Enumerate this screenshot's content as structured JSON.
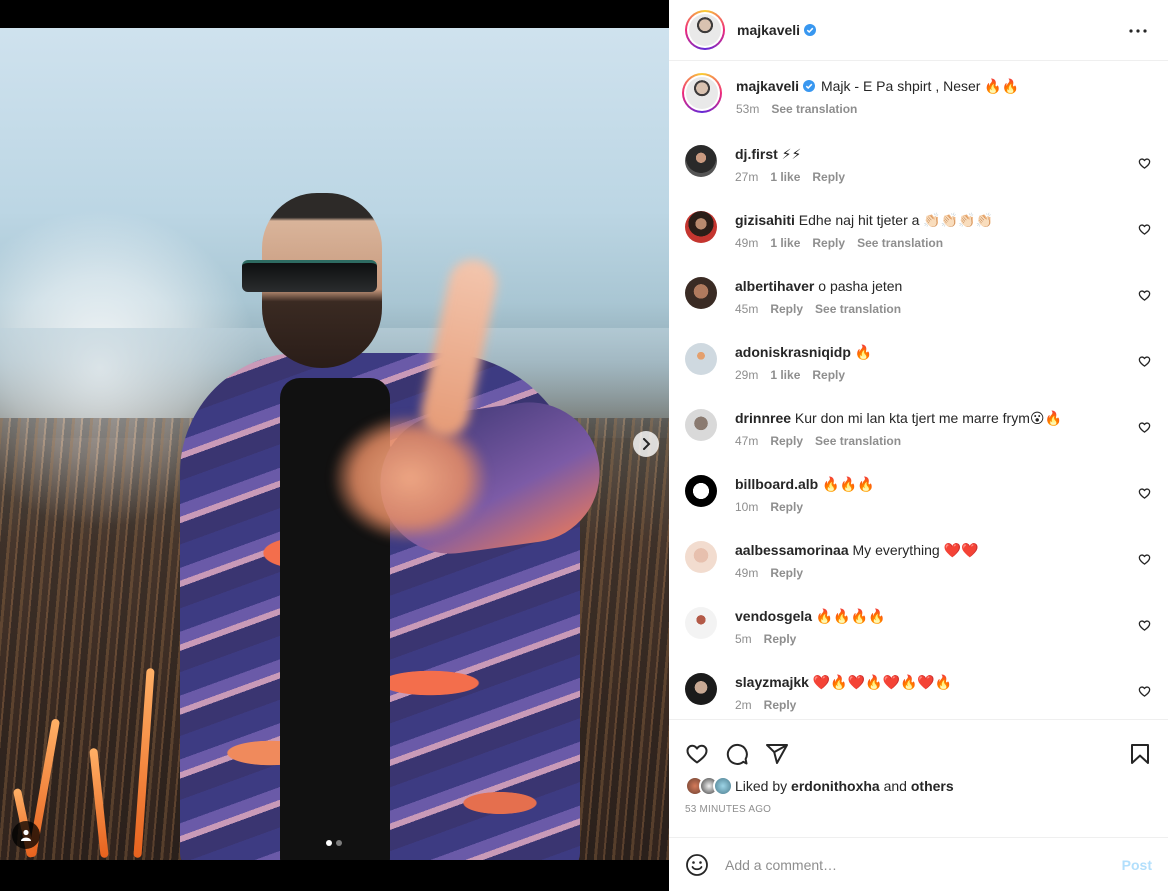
{
  "post": {
    "author": "majkaveli",
    "verified": true,
    "caption_text": "Majk - E Pa shpirt , Neser 🔥🔥",
    "caption_time": "53m",
    "see_translation": "See translation"
  },
  "carousel": {
    "total": 2,
    "active": 1
  },
  "comments": [
    {
      "user": "dj.first",
      "text": "⚡⚡",
      "time": "27m",
      "likes": "1 like",
      "reply": "Reply",
      "translation": ""
    },
    {
      "user": "gizisahiti",
      "text": "Edhe naj hit tjeter a 👏🏻👏🏻👏🏻👏🏻",
      "time": "49m",
      "likes": "1 like",
      "reply": "Reply",
      "translation": "See translation"
    },
    {
      "user": "albertihaver",
      "text": "o pasha jeten",
      "time": "45m",
      "likes": "",
      "reply": "Reply",
      "translation": "See translation"
    },
    {
      "user": "adoniskrasniqidp",
      "text": "🔥",
      "time": "29m",
      "likes": "1 like",
      "reply": "Reply",
      "translation": ""
    },
    {
      "user": "drinnree",
      "text": "Kur don mi lan kta tjert me marre frym😮🔥",
      "time": "47m",
      "likes": "",
      "reply": "Reply",
      "translation": "See translation"
    },
    {
      "user": "billboard.alb",
      "text": "🔥🔥🔥",
      "time": "10m",
      "likes": "",
      "reply": "Reply",
      "translation": ""
    },
    {
      "user": "aalbessamorinaa",
      "text": "My everything ❤️❤️",
      "time": "49m",
      "likes": "",
      "reply": "Reply",
      "translation": ""
    },
    {
      "user": "vendosgela",
      "text": "🔥🔥🔥🔥",
      "time": "5m",
      "likes": "",
      "reply": "Reply",
      "translation": ""
    },
    {
      "user": "slayzmajkk",
      "text": "❤️🔥❤️🔥❤️🔥❤️🔥",
      "time": "2m",
      "likes": "",
      "reply": "Reply",
      "translation": ""
    }
  ],
  "likes": {
    "prefix": "Liked by",
    "user": "erdonithoxha",
    "and": "and",
    "others": "others"
  },
  "timestamp": "53 MINUTES AGO",
  "add_comment": {
    "placeholder": "Add a comment…",
    "post_label": "Post"
  },
  "colors": {
    "link_blue": "#0095f6",
    "post_disabled": "#b2dffc",
    "verified_blue": "#3897f0",
    "meta_grey": "#8e8e8e"
  },
  "icons": [
    "more-icon",
    "heart-icon",
    "comment-icon",
    "share-icon",
    "bookmark-icon",
    "emoji-icon",
    "chevron-right-icon",
    "user-tag-icon",
    "verified-icon"
  ]
}
